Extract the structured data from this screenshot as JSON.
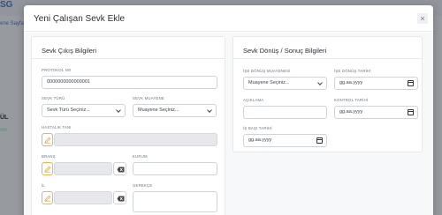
{
  "background": {
    "brand": "SG",
    "breadcrumb": "ene Sayfa",
    "left_text": "ÜL"
  },
  "modal": {
    "title": "Yeni Çalışan Sevk Ekle",
    "close_label": "×"
  },
  "left_card": {
    "title": "Sevk Çıkış Bilgileri",
    "protokol_label": "PROTOKOL NO",
    "protokol_value": "0000000000000001",
    "sevk_turu_label": "SEVK TÜRÜ",
    "sevk_turu_value": "Sevk Türü Seçiniz...",
    "sevk_muayene_label": "SEVK MUAYENE",
    "sevk_muayene_value": "Muayene Seçiniz...",
    "hastalik_label": "HASTALIK TANI",
    "brans_label": "BRANŞ",
    "kurum_label": "KURUM",
    "il_label": "İL",
    "gerekce_label": "GEREKÇE"
  },
  "right_card": {
    "title": "Sevk Dönüş / Sonuç Bilgileri",
    "ise_donus_muayene_label": "İŞE DÖNÜŞ MUAYENESİ",
    "ise_donus_muayene_value": "Muayene Seçiniz...",
    "ise_donus_tarihi_label": "İŞE DÖNÜŞ TARİHİ",
    "ise_donus_tarihi_value": "gg.aa.yyyy",
    "aciklama_label": "AÇIKLAMA",
    "kontrol_tarihi_label": "KONTROL TARİHİ",
    "kontrol_tarihi_value": "gg.aa.yyyy",
    "is_basi_tarihi_label": "İŞ BAŞI TARİHİ",
    "is_basi_tarihi_value": "gg.aa.yyyy"
  },
  "colors": {
    "accent": "#f0b24a",
    "brand": "#3f6dc6",
    "disabled_field": "#e6e8ec"
  }
}
